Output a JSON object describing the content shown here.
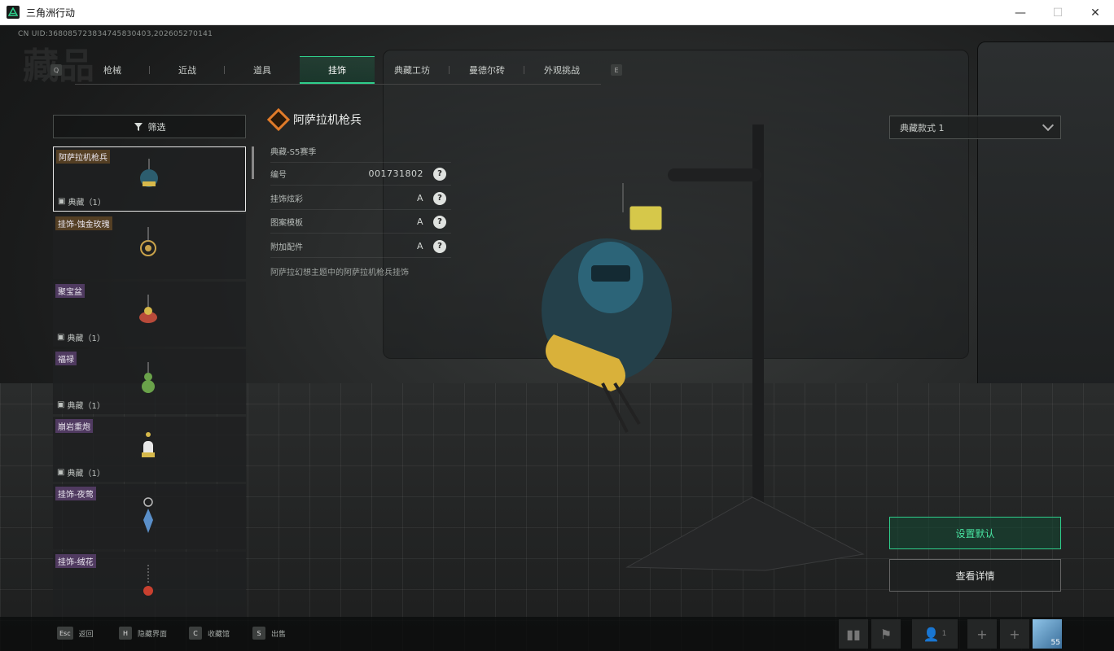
{
  "window": {
    "title": "三角洲行动",
    "minimize": "—",
    "maximize": "☐",
    "close": "✕"
  },
  "header": {
    "uid": "CN UID:368085723834745830403,202605270141",
    "page_word": "藏品",
    "key_left": "Q",
    "key_right": "E"
  },
  "tabs": [
    {
      "label": "枪械"
    },
    {
      "label": "近战"
    },
    {
      "label": "道具"
    },
    {
      "label": "挂饰"
    },
    {
      "label": "典藏工坊"
    },
    {
      "label": "曼德尔砖"
    },
    {
      "label": "外观挑战"
    }
  ],
  "active_tab": "挂饰",
  "filter": {
    "label": "筛选"
  },
  "items": [
    {
      "name": "阿萨拉机枪兵",
      "meta": "典藏（1）",
      "selected": true
    },
    {
      "name": "挂饰-蚀金玫瑰",
      "meta": ""
    },
    {
      "name": "聚宝盆",
      "meta": "典藏（1）"
    },
    {
      "name": "福禄",
      "meta": "典藏（1）"
    },
    {
      "name": "崩岩重炮",
      "meta": "典藏（1）"
    },
    {
      "name": "挂饰-夜莺",
      "meta": ""
    },
    {
      "name": "挂饰-绒花",
      "meta": ""
    }
  ],
  "detail": {
    "title": "阿萨拉机枪兵",
    "season": "典藏-S5赛季",
    "rows": [
      {
        "label": "编号",
        "value": "001731802"
      },
      {
        "label": "挂饰炫彩",
        "value": "A"
      },
      {
        "label": "图案模板",
        "value": "A"
      },
      {
        "label": "附加配件",
        "value": "A"
      }
    ],
    "description": "阿萨拉幻想主题中的阿萨拉机枪兵挂饰",
    "help": "?"
  },
  "style_select": {
    "value": "典藏款式 1"
  },
  "actions": {
    "set_default": "设置默认",
    "view_details": "查看详情"
  },
  "bottom": {
    "hints": [
      {
        "key": "Esc",
        "label": "返回"
      },
      {
        "key": "H",
        "label": "隐藏界面"
      },
      {
        "key": "C",
        "label": "收藏馆"
      },
      {
        "key": "S",
        "label": "出售"
      }
    ],
    "squad_count": "1",
    "level": "55"
  },
  "colors": {
    "accent": "#2fcf8c",
    "rarity_orange": "#e07b2a"
  }
}
